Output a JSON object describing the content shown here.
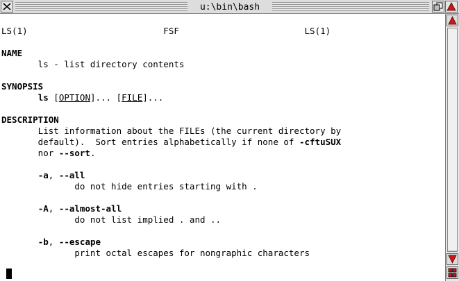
{
  "window": {
    "title": "u:\\bin\\bash"
  },
  "terminal": {
    "lines": [
      {
        "segments": [
          {
            "text": "LS(1)                          FSF                        LS(1)"
          }
        ]
      },
      {
        "segments": [
          {
            "text": ""
          }
        ]
      },
      {
        "segments": [
          {
            "text": "NAME",
            "bold": true
          }
        ]
      },
      {
        "segments": [
          {
            "text": "       ls - list directory contents"
          }
        ]
      },
      {
        "segments": [
          {
            "text": ""
          }
        ]
      },
      {
        "segments": [
          {
            "text": "SYNOPSIS",
            "bold": true
          }
        ]
      },
      {
        "segments": [
          {
            "text": "       "
          },
          {
            "text": "ls",
            "bold": true
          },
          {
            "text": " ["
          },
          {
            "text": "OPTION",
            "underline": true
          },
          {
            "text": "]... ["
          },
          {
            "text": "FILE",
            "underline": true
          },
          {
            "text": "]..."
          }
        ]
      },
      {
        "segments": [
          {
            "text": ""
          }
        ]
      },
      {
        "segments": [
          {
            "text": "DESCRIPTION",
            "bold": true
          }
        ]
      },
      {
        "segments": [
          {
            "text": "       List information about the FILEs (the current directory by"
          }
        ]
      },
      {
        "segments": [
          {
            "text": "       default).  Sort entries alphabetically if none of "
          },
          {
            "text": "-cftuSUX",
            "bold": true
          }
        ]
      },
      {
        "segments": [
          {
            "text": "       nor "
          },
          {
            "text": "--sort",
            "bold": true
          },
          {
            "text": "."
          }
        ]
      },
      {
        "segments": [
          {
            "text": ""
          }
        ]
      },
      {
        "segments": [
          {
            "text": "       "
          },
          {
            "text": "-a",
            "bold": true
          },
          {
            "text": ", "
          },
          {
            "text": "--all",
            "bold": true
          }
        ]
      },
      {
        "segments": [
          {
            "text": "              do not hide entries starting with ."
          }
        ]
      },
      {
        "segments": [
          {
            "text": ""
          }
        ]
      },
      {
        "segments": [
          {
            "text": "       "
          },
          {
            "text": "-A",
            "bold": true
          },
          {
            "text": ", "
          },
          {
            "text": "--almost-all",
            "bold": true
          }
        ]
      },
      {
        "segments": [
          {
            "text": "              do not list implied . and .."
          }
        ]
      },
      {
        "segments": [
          {
            "text": ""
          }
        ]
      },
      {
        "segments": [
          {
            "text": "       "
          },
          {
            "text": "-b",
            "bold": true
          },
          {
            "text": ", "
          },
          {
            "text": "--escape",
            "bold": true
          }
        ]
      },
      {
        "segments": [
          {
            "text": "              print octal escapes for nongraphic characters"
          }
        ]
      },
      {
        "segments": [
          {
            "text": ""
          }
        ]
      },
      {
        "segments": [
          {
            "text": ""
          }
        ]
      },
      {
        "segments": [
          {
            "text": ":"
          }
        ]
      }
    ]
  },
  "scrollbar": {
    "position": 0.0,
    "visible_fraction": 1.0
  },
  "icons": {
    "close": "close-icon",
    "back": "back-icon",
    "full": "toggle-size-icon",
    "up": "scroll-up-icon",
    "down": "scroll-down-icon",
    "resize": "resize-icon"
  },
  "colors": {
    "arrow_red": "#c81818",
    "titlebar": "#dddddd"
  }
}
